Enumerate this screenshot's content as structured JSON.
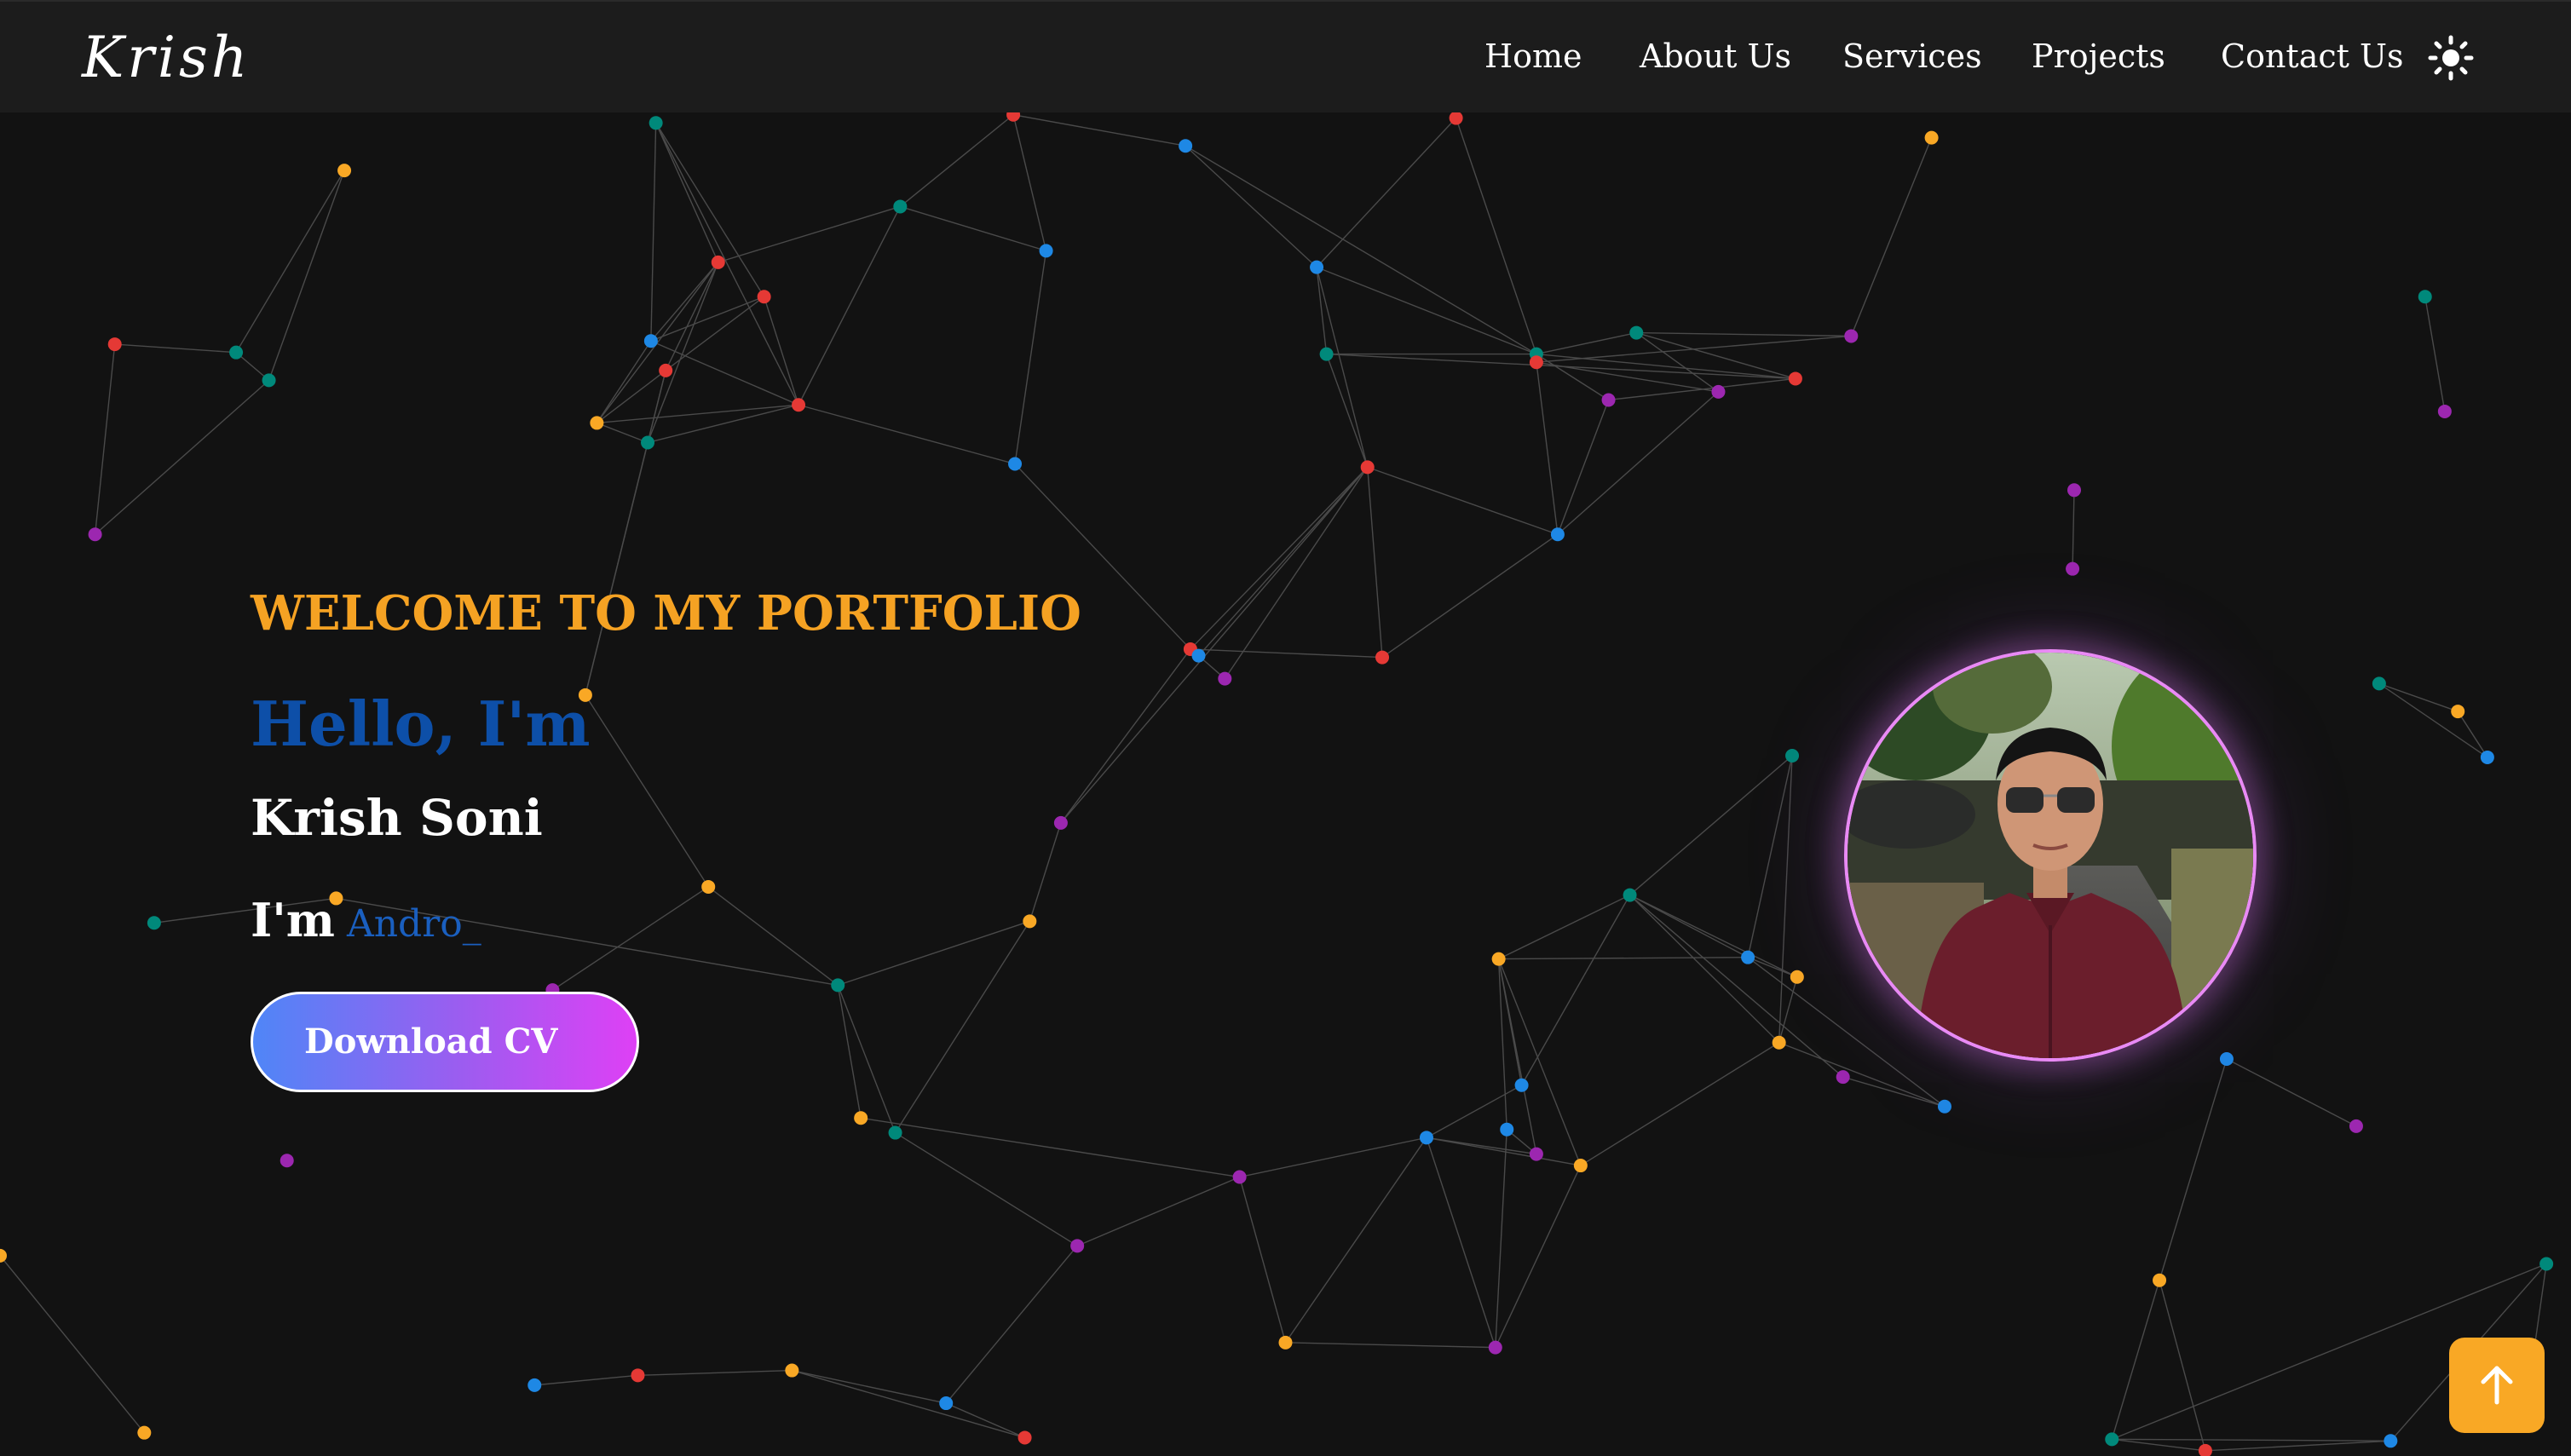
{
  "navbar": {
    "logo": "Krish",
    "links": [
      "Home",
      "About Us",
      "Services",
      "Projects",
      "Contact Us"
    ],
    "theme_icon": "sun-icon"
  },
  "hero": {
    "welcome": "WELCOME TO MY PORTFOLIO",
    "hello": "Hello, I'm",
    "name": "Krish Soni",
    "role_prefix": "I'm",
    "role_typed": "Andro_",
    "download_label": "Download CV"
  },
  "avatar": {
    "icon": "profile-photo"
  },
  "scroll_top": {
    "icon": "arrow-up-icon"
  },
  "colors": {
    "background": "#121212",
    "navbar": "#1c1c1c",
    "accent_orange": "#f5a223",
    "accent_blue": "#0d4fa8",
    "button_gradient_start": "#4f86f7",
    "button_gradient_end": "#de40f5",
    "avatar_glow": "#e98af5",
    "particle_colors": [
      "#e53935",
      "#1e88e5",
      "#00897b",
      "#f9a825",
      "#9c27b0"
    ]
  }
}
